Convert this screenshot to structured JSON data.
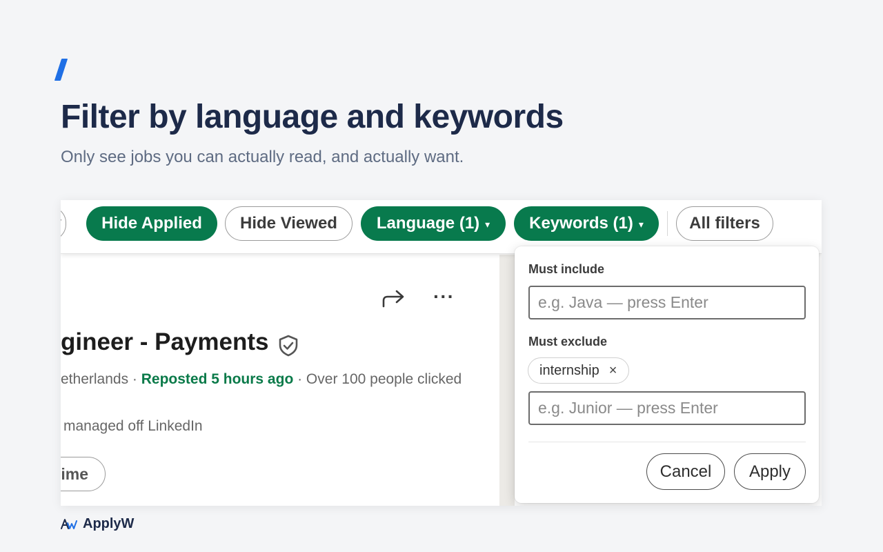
{
  "header": {
    "title": "Filter by language and keywords",
    "subtitle": "Only see jobs you can actually read, and actually want."
  },
  "filter_bar": {
    "partial_pill": "y",
    "hide_applied": "Hide Applied",
    "hide_viewed": "Hide Viewed",
    "language": "Language (1)",
    "keywords": "Keywords (1)",
    "all_filters": "All filters",
    "caret": "▾"
  },
  "job": {
    "title": "gineer - Payments",
    "location": "etherlands · ",
    "reposted": "Reposted 5 hours ago",
    "clicked": " · Over 100 people clicked",
    "managed": "managed off LinkedIn",
    "partial_button": "ime",
    "more": "···"
  },
  "keywords_dropdown": {
    "include_label": "Must include",
    "include_placeholder": "e.g. Java — press Enter",
    "exclude_label": "Must exclude",
    "exclude_chips": [
      "internship"
    ],
    "chip_remove": "×",
    "exclude_placeholder": "e.g. Junior — press Enter",
    "cancel": "Cancel",
    "apply": "Apply"
  },
  "brand": {
    "name": "ApplyW"
  },
  "colors": {
    "accent": "#1f6fe5",
    "filter_active": "#087a4d",
    "heading": "#1d2a49",
    "reposted": "#0a7a49"
  }
}
